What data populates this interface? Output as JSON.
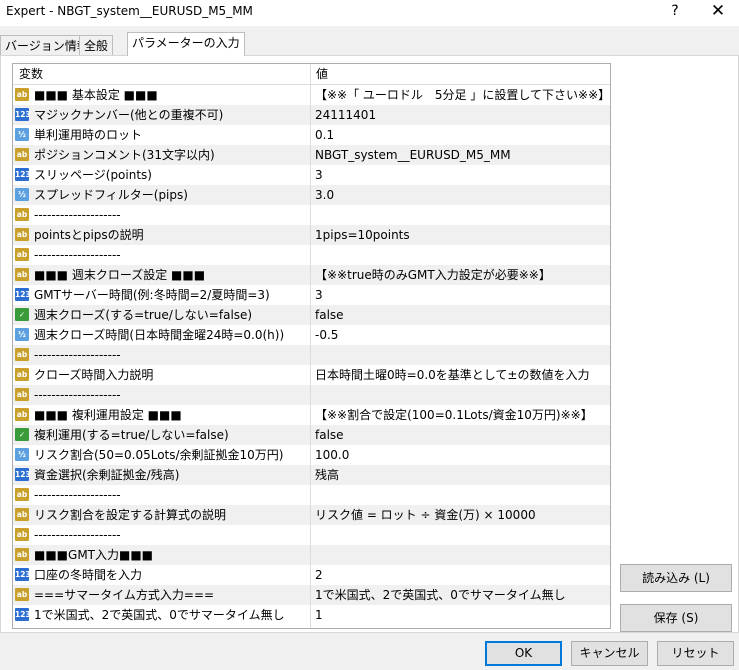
{
  "window": {
    "title": "Expert - NBGT_system__EURUSD_M5_MM",
    "help_label": "?",
    "close_label": "✕"
  },
  "tabs": [
    {
      "label": "バージョン情報"
    },
    {
      "label": "全般"
    },
    {
      "label": "パラメーターの入力"
    }
  ],
  "table": {
    "headers": {
      "name": "変数",
      "value": "値"
    },
    "rows": [
      {
        "type": "string",
        "icon": "ab",
        "name": "■■■ 基本設定 ■■■",
        "value": "【※※「 ユーロドル　5分足 」に設置して下さい※※】"
      },
      {
        "type": "int",
        "icon": "123",
        "name": "マジックナンバー(他との重複不可)",
        "value": "24111401"
      },
      {
        "type": "double",
        "icon": "½",
        "name": "単利運用時のロット",
        "value": "0.1"
      },
      {
        "type": "string",
        "icon": "ab",
        "name": "ポジションコメント(31文字以内)",
        "value": "NBGT_system__EURUSD_M5_MM"
      },
      {
        "type": "int",
        "icon": "123",
        "name": "スリッページ(points)",
        "value": "3"
      },
      {
        "type": "double",
        "icon": "½",
        "name": "スプレッドフィルター(pips)",
        "value": "3.0"
      },
      {
        "type": "string",
        "icon": "ab",
        "name": "--------------------",
        "value": ""
      },
      {
        "type": "string",
        "icon": "ab",
        "name": "pointsとpipsの説明",
        "value": "1pips=10points"
      },
      {
        "type": "string",
        "icon": "ab",
        "name": "--------------------",
        "value": ""
      },
      {
        "type": "string",
        "icon": "ab",
        "name": "■■■ 週末クローズ設定 ■■■",
        "value": "【※※true時のみGMT入力設定が必要※※】"
      },
      {
        "type": "int",
        "icon": "123",
        "name": "GMTサーバー時間(例:冬時間=2/夏時間=3)",
        "value": "3"
      },
      {
        "type": "bool",
        "icon": "✓",
        "name": "週末クローズ(する=true/しない=false)",
        "value": "false"
      },
      {
        "type": "double",
        "icon": "½",
        "name": "週末クローズ時間(日本時間金曜24時=0.0(h))",
        "value": "-0.5"
      },
      {
        "type": "string",
        "icon": "ab",
        "name": "--------------------",
        "value": ""
      },
      {
        "type": "string",
        "icon": "ab",
        "name": "クローズ時間入力説明",
        "value": "日本時間土曜0時=0.0を基準として±の数値を入力"
      },
      {
        "type": "string",
        "icon": "ab",
        "name": "--------------------",
        "value": ""
      },
      {
        "type": "string",
        "icon": "ab",
        "name": "■■■ 複利運用設定 ■■■",
        "value": "【※※割合で設定(100=0.1Lots/資金10万円)※※】"
      },
      {
        "type": "bool",
        "icon": "✓",
        "name": "複利運用(する=true/しない=false)",
        "value": "false"
      },
      {
        "type": "double",
        "icon": "½",
        "name": "リスク割合(50=0.05Lots/余剰証拠金10万円)",
        "value": "100.0"
      },
      {
        "type": "int",
        "icon": "123",
        "name": "資金選択(余剰証拠金/残高)",
        "value": "残高"
      },
      {
        "type": "string",
        "icon": "ab",
        "name": "--------------------",
        "value": ""
      },
      {
        "type": "string",
        "icon": "ab",
        "name": "リスク割合を設定する計算式の説明",
        "value": "リスク値 = ロット ÷ 資金(万) × 10000"
      },
      {
        "type": "string",
        "icon": "ab",
        "name": "--------------------",
        "value": ""
      },
      {
        "type": "string",
        "icon": "ab",
        "name": "■■■GMT入力■■■",
        "value": ""
      },
      {
        "type": "int",
        "icon": "123",
        "name": "口座の冬時間を入力",
        "value": "2"
      },
      {
        "type": "string",
        "icon": "ab",
        "name": "===サマータイム方式入力===",
        "value": "1で米国式、2で英国式、0でサマータイム無し"
      },
      {
        "type": "int",
        "icon": "123",
        "name": "1で米国式、2で英国式、0でサマータイム無し",
        "value": "1"
      }
    ]
  },
  "side_buttons": {
    "load_label": "読み込み (L)",
    "save_label": "保存 (S)"
  },
  "footer": {
    "ok_label": "OK",
    "cancel_label": "キャンセル",
    "reset_label": "リセット"
  }
}
